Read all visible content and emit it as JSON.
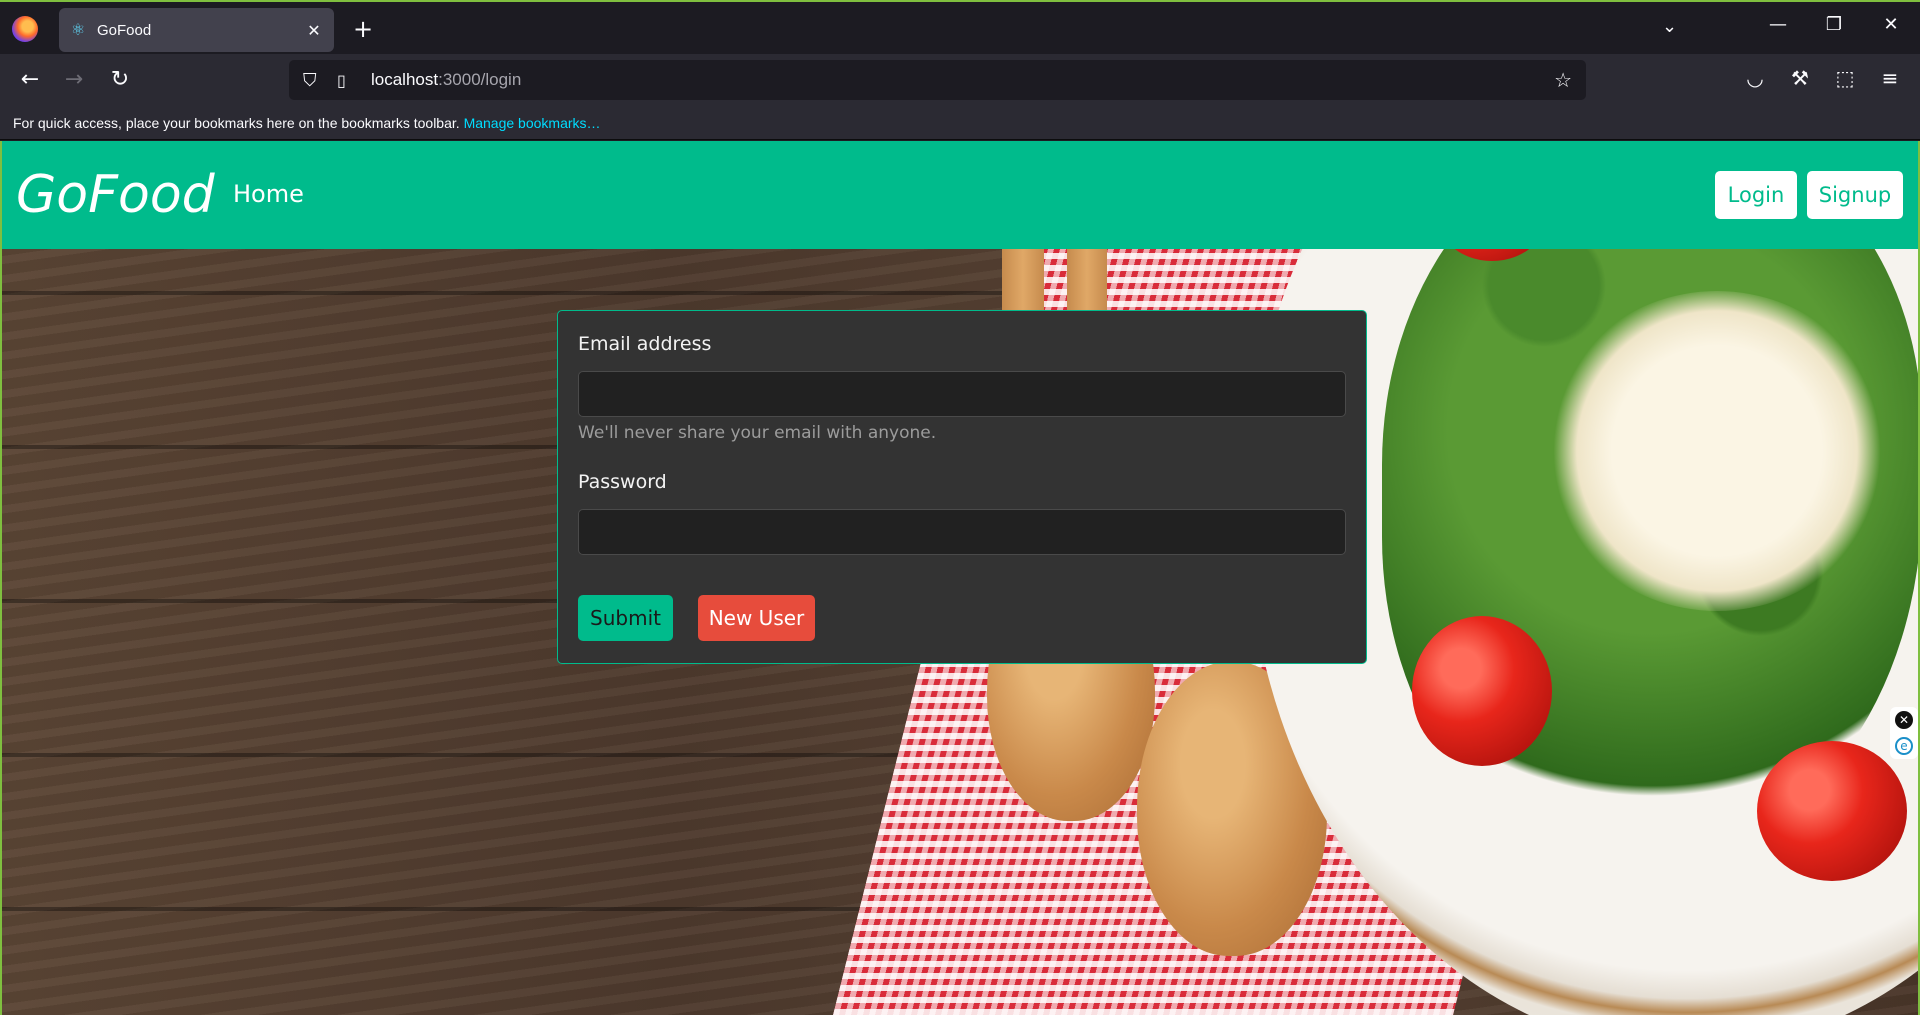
{
  "browser": {
    "tab_title": "GoFood",
    "tab_favicon": "react-icon",
    "url_host": "localhost",
    "url_path": ":3000/login",
    "bookmarks_text": "For quick access, place your bookmarks here on the bookmarks toolbar.",
    "bookmarks_link": "Manage bookmarks…"
  },
  "header": {
    "brand": "GoFood",
    "home": "Home",
    "login": "Login",
    "signup": "Signup",
    "color": "#00bb8c"
  },
  "form": {
    "email_label": "Email address",
    "email_value": "",
    "email_help": "We'll never share your email with anyone.",
    "password_label": "Password",
    "password_value": "",
    "submit": "Submit",
    "new_user": "New User"
  },
  "icons": {
    "plus": "+",
    "chevron": "⌄",
    "close": "✕",
    "minimize": "—",
    "restore": "❐"
  }
}
